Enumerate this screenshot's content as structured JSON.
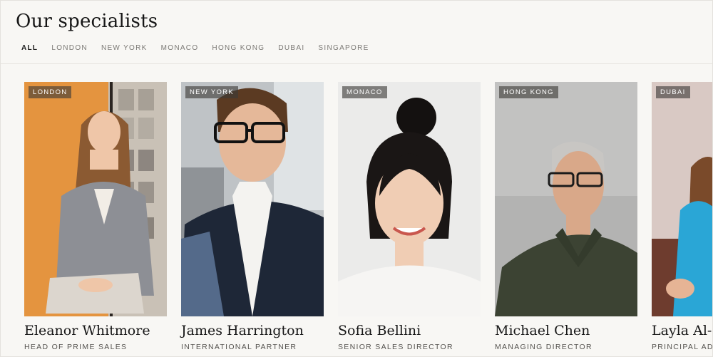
{
  "section": {
    "title": "Our specialists"
  },
  "filters": [
    {
      "label": "ALL",
      "active": true
    },
    {
      "label": "LONDON",
      "active": false
    },
    {
      "label": "NEW YORK",
      "active": false
    },
    {
      "label": "MONACO",
      "active": false
    },
    {
      "label": "HONG KONG",
      "active": false
    },
    {
      "label": "DUBAI",
      "active": false
    },
    {
      "label": "SINGAPORE",
      "active": false
    }
  ],
  "specialists": [
    {
      "city": "LONDON",
      "name": "Eleanor Whitmore",
      "role": "HEAD OF PRIME SALES"
    },
    {
      "city": "NEW YORK",
      "name": "James Harrington",
      "role": "INTERNATIONAL PARTNER"
    },
    {
      "city": "MONACO",
      "name": "Sofia Bellini",
      "role": "SENIOR SALES DIRECTOR"
    },
    {
      "city": "HONG KONG",
      "name": "Michael Chen",
      "role": "MANAGING DIRECTOR"
    },
    {
      "city": "DUBAI",
      "name": "Layla Al-F",
      "role": "PRINCIPAL AD"
    }
  ],
  "colors": {
    "background": "#f8f7f4",
    "badge": "#3c3a37",
    "text": "#1b1b1b",
    "muted": "#7b7975"
  }
}
